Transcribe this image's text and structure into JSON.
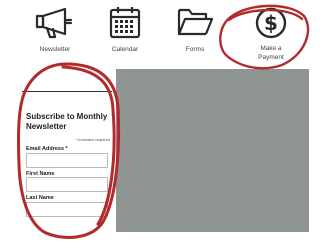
{
  "nav": {
    "newsletter_label": "Newsletter",
    "calendar_label": "Calendar",
    "forms_label": "Forms",
    "payment_label_line1": "Make a",
    "payment_label_line2": "Payment",
    "payment_icon_glyph": "$"
  },
  "icons": {
    "newsletter": "megaphone-icon",
    "calendar": "calendar-icon",
    "forms": "folder-icon",
    "payment": "dollar-circle-icon"
  },
  "form": {
    "title": "Subscribe to Monthly Newsletter",
    "required_note": "* indicates required",
    "email_label": "Email Address *",
    "first_name_label": "First Name",
    "last_name_label": "Last Name",
    "email_value": "",
    "first_name_value": "",
    "last_name_value": ""
  },
  "colors": {
    "annotation": "#b22a2e",
    "panel": "#8f9591",
    "icon": "#2a2a2a"
  }
}
